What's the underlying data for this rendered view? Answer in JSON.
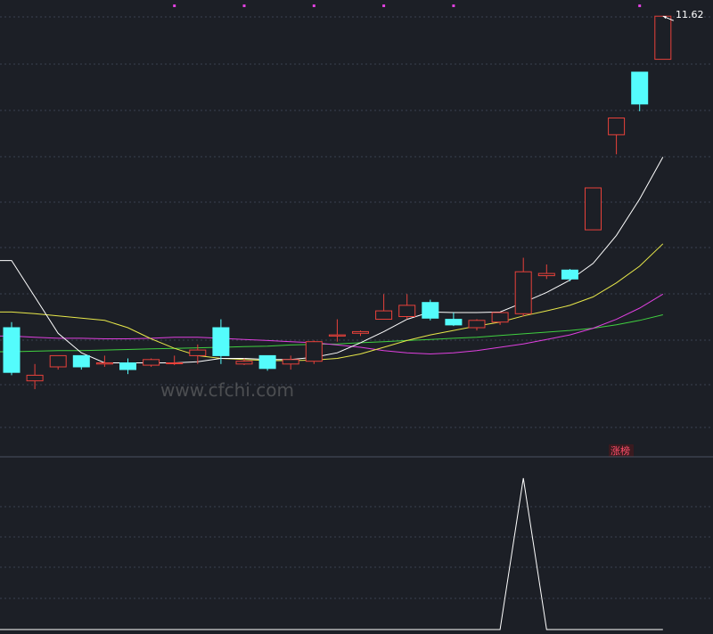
{
  "chart_data": {
    "type": "candlestick",
    "ylim": [
      3.9,
      11.75
    ],
    "last_price_label": "11.62",
    "badge": {
      "text": "涨榜",
      "color": "#ff4e6a",
      "bg": "#3a1a1f"
    },
    "watermark": "www.cfchi.com",
    "colors": {
      "up": "#e8413a",
      "down": "#54fcfc",
      "ma5": "#ffffff",
      "ma10": "#e8e84a",
      "ma20": "#e040e0",
      "ma60": "#40d040",
      "grid": "#3a4150",
      "marker": "#e040e0",
      "lower_line": "#ffffff"
    },
    "candles": [
      {
        "o": 6.05,
        "c": 5.25,
        "h": 6.15,
        "l": 5.2
      },
      {
        "o": 5.1,
        "c": 5.2,
        "h": 5.4,
        "l": 4.95
      },
      {
        "o": 5.35,
        "c": 5.55,
        "h": 5.55,
        "l": 5.3
      },
      {
        "o": 5.55,
        "c": 5.35,
        "h": 5.55,
        "l": 5.3
      },
      {
        "o": 5.4,
        "c": 5.42,
        "h": 5.55,
        "l": 5.35
      },
      {
        "o": 5.42,
        "c": 5.3,
        "h": 5.5,
        "l": 5.22
      },
      {
        "o": 5.38,
        "c": 5.48,
        "h": 5.5,
        "l": 5.35
      },
      {
        "o": 5.42,
        "c": 5.42,
        "h": 5.55,
        "l": 5.38
      },
      {
        "o": 5.55,
        "c": 5.65,
        "h": 5.75,
        "l": 5.4
      },
      {
        "o": 6.05,
        "c": 5.55,
        "h": 6.2,
        "l": 5.4
      },
      {
        "o": 5.4,
        "c": 5.45,
        "h": 5.5,
        "l": 5.38
      },
      {
        "o": 5.55,
        "c": 5.32,
        "h": 5.55,
        "l": 5.28
      },
      {
        "o": 5.4,
        "c": 5.48,
        "h": 5.55,
        "l": 5.3
      },
      {
        "o": 5.45,
        "c": 5.8,
        "h": 5.82,
        "l": 5.4
      },
      {
        "o": 5.9,
        "c": 5.92,
        "h": 6.2,
        "l": 5.8
      },
      {
        "o": 5.95,
        "c": 5.98,
        "h": 6.0,
        "l": 5.9
      },
      {
        "o": 6.2,
        "c": 6.35,
        "h": 6.65,
        "l": 6.2
      },
      {
        "o": 6.25,
        "c": 6.45,
        "h": 6.65,
        "l": 6.2
      },
      {
        "o": 6.5,
        "c": 6.22,
        "h": 6.55,
        "l": 6.18
      },
      {
        "o": 6.2,
        "c": 6.1,
        "h": 6.32,
        "l": 6.08
      },
      {
        "o": 6.05,
        "c": 6.18,
        "h": 6.2,
        "l": 6.0
      },
      {
        "o": 6.15,
        "c": 6.32,
        "h": 6.32,
        "l": 6.1
      },
      {
        "o": 6.3,
        "c": 7.05,
        "h": 7.3,
        "l": 6.25
      },
      {
        "o": 6.98,
        "c": 7.02,
        "h": 7.18,
        "l": 6.92
      },
      {
        "o": 7.08,
        "c": 6.92,
        "h": 7.1,
        "l": 6.88
      },
      {
        "o": 7.8,
        "c": 8.55,
        "h": 8.55,
        "l": 7.8
      },
      {
        "o": 9.5,
        "c": 9.8,
        "h": 9.8,
        "l": 9.15
      },
      {
        "o": 10.62,
        "c": 10.05,
        "h": 10.62,
        "l": 9.92
      },
      {
        "o": 10.85,
        "c": 11.62,
        "h": 11.62,
        "l": 10.85
      }
    ],
    "ma5": [
      7.25,
      6.6,
      5.95,
      5.6,
      5.42,
      5.42,
      5.42,
      5.42,
      5.44,
      5.5,
      5.5,
      5.48,
      5.48,
      5.52,
      5.6,
      5.78,
      5.98,
      6.2,
      6.33,
      6.32,
      6.32,
      6.33,
      6.5,
      6.68,
      6.9,
      7.2,
      7.7,
      8.35,
      9.1
    ],
    "ma10": [
      6.33,
      6.3,
      6.26,
      6.22,
      6.18,
      6.05,
      5.85,
      5.68,
      5.55,
      5.5,
      5.48,
      5.46,
      5.46,
      5.47,
      5.5,
      5.58,
      5.7,
      5.82,
      5.92,
      6.0,
      6.08,
      6.15,
      6.26,
      6.35,
      6.45,
      6.6,
      6.85,
      7.15,
      7.55
    ],
    "ma20": [
      5.9,
      5.88,
      5.86,
      5.86,
      5.85,
      5.85,
      5.86,
      5.88,
      5.88,
      5.86,
      5.84,
      5.82,
      5.8,
      5.78,
      5.74,
      5.7,
      5.64,
      5.6,
      5.58,
      5.6,
      5.64,
      5.7,
      5.76,
      5.84,
      5.92,
      6.04,
      6.2,
      6.4,
      6.65
    ],
    "ma60": [
      5.62,
      5.63,
      5.64,
      5.64,
      5.65,
      5.66,
      5.67,
      5.68,
      5.69,
      5.7,
      5.71,
      5.72,
      5.74,
      5.75,
      5.76,
      5.78,
      5.8,
      5.82,
      5.84,
      5.86,
      5.88,
      5.91,
      5.94,
      5.97,
      6.0,
      6.04,
      6.1,
      6.18,
      6.28
    ],
    "top_markers": [
      7,
      10,
      13,
      16,
      19,
      27
    ],
    "lower_indicator": {
      "ylim": [
        0,
        1
      ],
      "values": [
        0,
        0,
        0,
        0,
        0,
        0,
        0,
        0,
        0,
        0,
        0,
        0,
        0,
        0,
        0,
        0,
        0,
        0,
        0,
        0,
        0,
        0,
        1,
        0,
        0,
        0,
        0,
        0,
        0
      ]
    }
  }
}
